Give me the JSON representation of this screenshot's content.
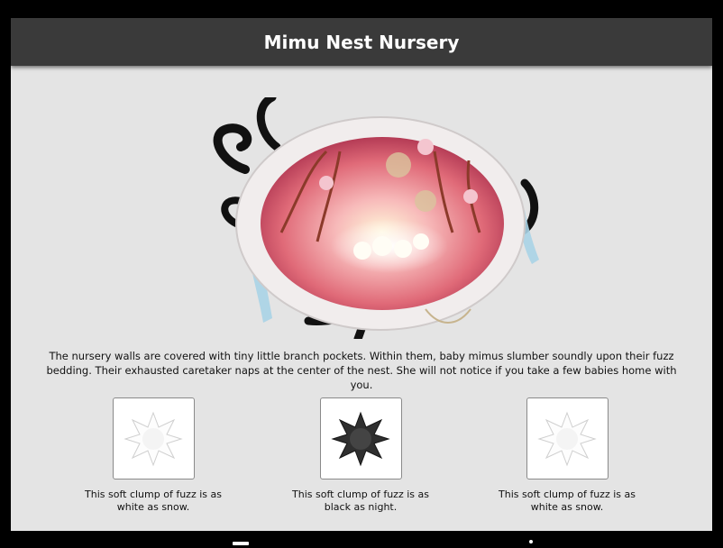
{
  "header": {
    "title": "Mimu Nest Nursery"
  },
  "description": "The nursery walls are covered with tiny little branch pockets. Within them, baby mimus slumber soundly upon their fuzz bedding. Their exhausted caretaker naps at the center of the nest. She will not notice if you take a few babies home with you.",
  "items": [
    {
      "caption": "This soft clump of fuzz is as white as snow.",
      "color": "#ffffff",
      "icon": "white-fuzz-icon"
    },
    {
      "caption": "This soft clump of fuzz is as black as night.",
      "color": "#333333",
      "icon": "black-fuzz-icon"
    },
    {
      "caption": "This soft clump of fuzz is as white as snow.",
      "color": "#ffffff",
      "icon": "white-fuzz-icon"
    }
  ]
}
